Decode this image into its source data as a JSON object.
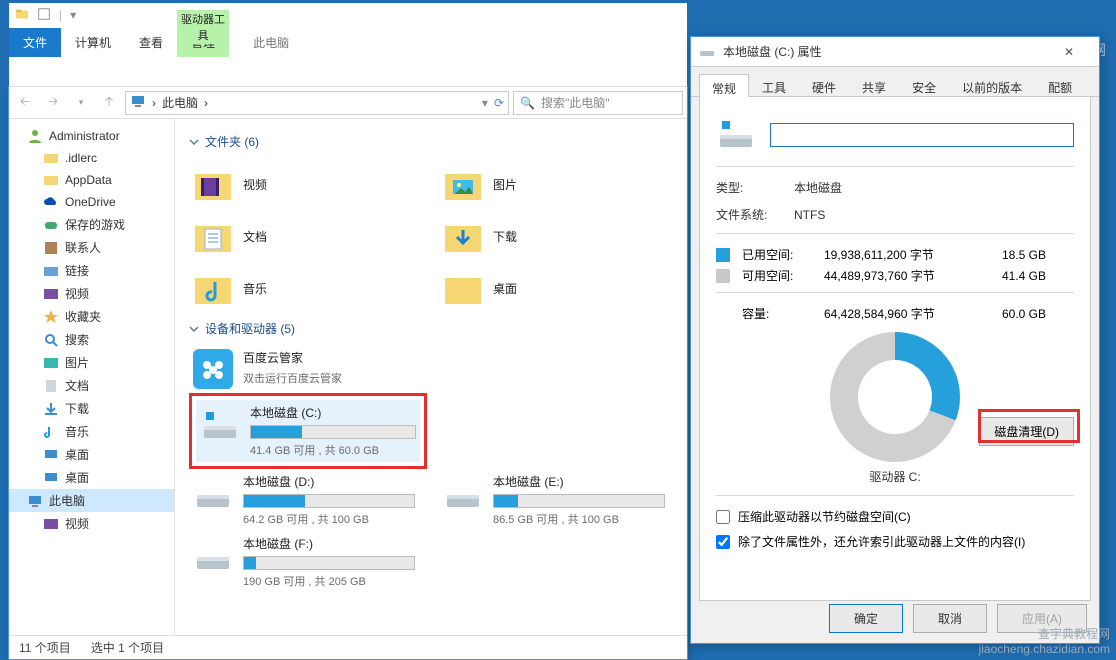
{
  "explorer": {
    "qat_title": "此电脑",
    "tabs": {
      "file": "文件",
      "computer": "计算机",
      "view": "查看",
      "drive_tools": "驱动器工具",
      "manage": "管理"
    },
    "breadcrumb": "此电脑",
    "breadcrumb_sep": "›",
    "search_placeholder": "搜索\"此电脑\"",
    "tree": {
      "admin": "Administrator",
      "idlerc": ".idlerc",
      "appdata": "AppData",
      "onedrive": "OneDrive",
      "savedgames": "保存的游戏",
      "contacts": "联系人",
      "links": "链接",
      "videos": "视频",
      "favorites": "收藏夹",
      "searches": "搜索",
      "pictures": "图片",
      "documents": "文档",
      "downloads": "下载",
      "music": "音乐",
      "desktop": "桌面",
      "desktop2": "桌面",
      "thispc": "此电脑",
      "videos2": "视频"
    },
    "groups": {
      "folders": "文件夹 (6)",
      "devices": "设备和驱动器 (5)"
    },
    "folders": {
      "videos": "视频",
      "pictures": "图片",
      "documents": "文档",
      "downloads": "下载",
      "music": "音乐",
      "desktop": "桌面"
    },
    "drives": {
      "baidu": {
        "name": "百度云管家",
        "sub": "双击运行百度云管家"
      },
      "c": {
        "name": "本地磁盘 (C:)",
        "sub": "41.4 GB 可用 , 共 60.0 GB",
        "pct": 31
      },
      "d": {
        "name": "本地磁盘 (D:)",
        "sub": "64.2 GB 可用 , 共 100 GB",
        "pct": 36
      },
      "e": {
        "name": "本地磁盘 (E:)",
        "sub": "86.5 GB 可用 , 共 100 GB",
        "pct": 14
      },
      "f": {
        "name": "本地磁盘 (F:)",
        "sub": "190 GB 可用 , 共 205 GB",
        "pct": 7
      }
    },
    "status": {
      "count": "11 个项目",
      "selected": "选中 1 个项目"
    }
  },
  "props": {
    "title": "本地磁盘 (C:) 属性",
    "tabs": {
      "general": "常规",
      "tools": "工具",
      "hardware": "硬件",
      "sharing": "共享",
      "security": "安全",
      "prev": "以前的版本",
      "quota": "配额"
    },
    "type_label": "类型:",
    "type_value": "本地磁盘",
    "fs_label": "文件系统:",
    "fs_value": "NTFS",
    "used": {
      "label": "已用空间:",
      "bytes": "19,938,611,200 字节",
      "gb": "18.5 GB"
    },
    "free": {
      "label": "可用空间:",
      "bytes": "44,489,973,760 字节",
      "gb": "41.4 GB"
    },
    "cap": {
      "label": "容量:",
      "bytes": "64,428,584,960 字节",
      "gb": "60.0 GB"
    },
    "drive_label": "驱动器 C:",
    "cleanup": "磁盘清理(D)",
    "chk1": "压缩此驱动器以节约磁盘空间(C)",
    "chk2": "除了文件属性外，还允许索引此驱动器上文件的内容(I)",
    "ok": "确定",
    "cancel": "取消",
    "apply": "应用(A)"
  },
  "watermark": {
    "top": "查字典 教程网",
    "line1": "查字典教程网",
    "line2": "jiaocheng.chazidian.com"
  }
}
